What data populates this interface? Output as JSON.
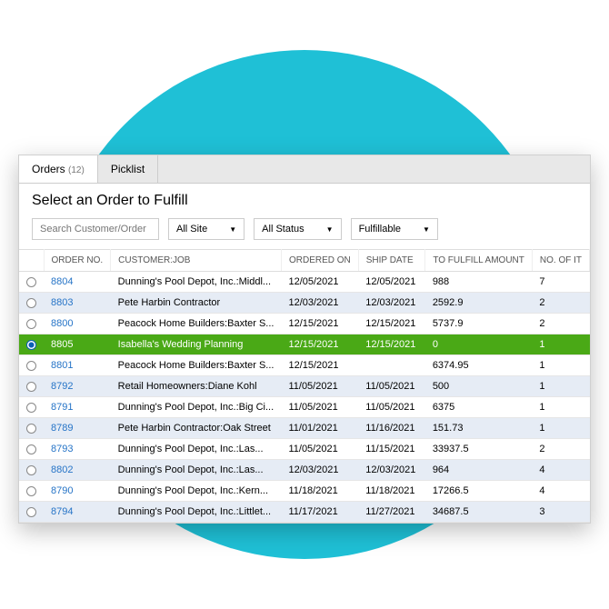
{
  "tabs": {
    "orders_label": "Orders",
    "orders_count": "(12)",
    "picklist_label": "Picklist"
  },
  "heading": "Select an Order to Fulfill",
  "filters": {
    "search_placeholder": "Search Customer/Order",
    "site": "All Site",
    "status": "All Status",
    "fulfill": "Fulfillable"
  },
  "columns": {
    "order_no": "ORDER NO.",
    "customer": "CUSTOMER:JOB",
    "ordered_on": "ORDERED ON",
    "ship_date": "SHIP DATE",
    "to_fulfill": "TO FULFILL AMOUNT",
    "no_of": "NO. OF IT"
  },
  "rows": [
    {
      "order": "8804",
      "customer": "Dunning's Pool Depot, Inc.:Middl...",
      "ordered": "12/05/2021",
      "ship": "12/05/2021",
      "amount": "988",
      "items": "7",
      "alt": false,
      "selected": false
    },
    {
      "order": "8803",
      "customer": "Pete Harbin Contractor",
      "ordered": "12/03/2021",
      "ship": "12/03/2021",
      "amount": "2592.9",
      "items": "2",
      "alt": true,
      "selected": false
    },
    {
      "order": "8800",
      "customer": "Peacock Home Builders:Baxter S...",
      "ordered": "12/15/2021",
      "ship": "12/15/2021",
      "amount": "5737.9",
      "items": "2",
      "alt": false,
      "selected": false
    },
    {
      "order": "8805",
      "customer": "Isabella's Wedding Planning",
      "ordered": "12/15/2021",
      "ship": "12/15/2021",
      "amount": "0",
      "items": "1",
      "alt": false,
      "selected": true
    },
    {
      "order": "8801",
      "customer": "Peacock Home Builders:Baxter S...",
      "ordered": "12/15/2021",
      "ship": "",
      "amount": "6374.95",
      "items": "1",
      "alt": false,
      "selected": false
    },
    {
      "order": "8792",
      "customer": "Retail Homeowners:Diane Kohl",
      "ordered": "11/05/2021",
      "ship": "11/05/2021",
      "amount": "500",
      "items": "1",
      "alt": true,
      "selected": false
    },
    {
      "order": "8791",
      "customer": "Dunning's Pool Depot, Inc.:Big Ci...",
      "ordered": "11/05/2021",
      "ship": "11/05/2021",
      "amount": "6375",
      "items": "1",
      "alt": false,
      "selected": false
    },
    {
      "order": "8789",
      "customer": "Pete Harbin Contractor:Oak Street",
      "ordered": "11/01/2021",
      "ship": "11/16/2021",
      "amount": "151.73",
      "items": "1",
      "alt": true,
      "selected": false
    },
    {
      "order": "8793",
      "customer": "Dunning's Pool Depot, Inc.:Las...",
      "ordered": "11/05/2021",
      "ship": "11/15/2021",
      "amount": "33937.5",
      "items": "2",
      "alt": false,
      "selected": false
    },
    {
      "order": "8802",
      "customer": "Dunning's Pool Depot, Inc.:Las...",
      "ordered": "12/03/2021",
      "ship": "12/03/2021",
      "amount": "964",
      "items": "4",
      "alt": true,
      "selected": false
    },
    {
      "order": "8790",
      "customer": "Dunning's Pool Depot, Inc.:Kern...",
      "ordered": "11/18/2021",
      "ship": "11/18/2021",
      "amount": "17266.5",
      "items": "4",
      "alt": false,
      "selected": false
    },
    {
      "order": "8794",
      "customer": "Dunning's Pool Depot, Inc.:Littlet...",
      "ordered": "11/17/2021",
      "ship": "11/27/2021",
      "amount": "34687.5",
      "items": "3",
      "alt": true,
      "selected": false
    }
  ]
}
